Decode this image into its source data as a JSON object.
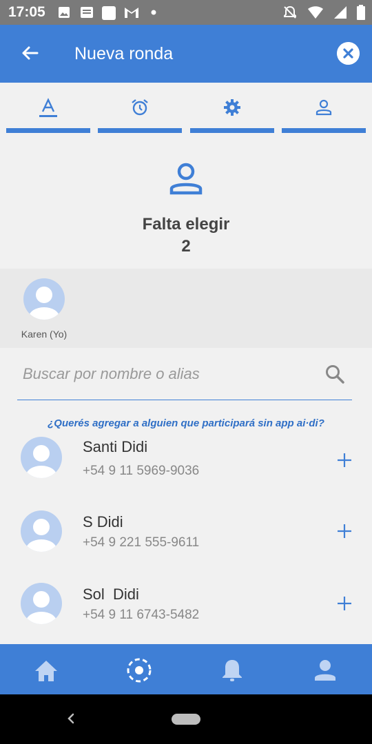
{
  "status_bar": {
    "time": "17:05"
  },
  "app_bar": {
    "title": "Nueva ronda"
  },
  "tabs": [
    {
      "icon": "text-icon"
    },
    {
      "icon": "alarm-icon"
    },
    {
      "icon": "gear-icon"
    },
    {
      "icon": "person-icon"
    }
  ],
  "missing": {
    "label": "Falta elegir",
    "count": "2"
  },
  "selected": [
    {
      "label": "Karen (Yo)"
    }
  ],
  "search": {
    "placeholder": "Buscar por nombre o alias"
  },
  "invite_link": "¿Querés agregar a alguien que participará sin app ai·di?",
  "contacts": [
    {
      "name": "Santi Didi",
      "phone": "+54 9 11 5969-9036"
    },
    {
      "name": "S Didi",
      "phone": "+54 9 221 555-9611"
    },
    {
      "name": "Sol  Didi",
      "phone": "+54 9 11 6743-5482"
    }
  ],
  "bottom_nav": [
    {
      "icon": "home-icon"
    },
    {
      "icon": "target-icon"
    },
    {
      "icon": "bell-icon"
    },
    {
      "icon": "profile-icon"
    }
  ],
  "colors": {
    "primary": "#3f7fd6",
    "background": "#f1f1f1",
    "avatar": "#b9cff0"
  }
}
